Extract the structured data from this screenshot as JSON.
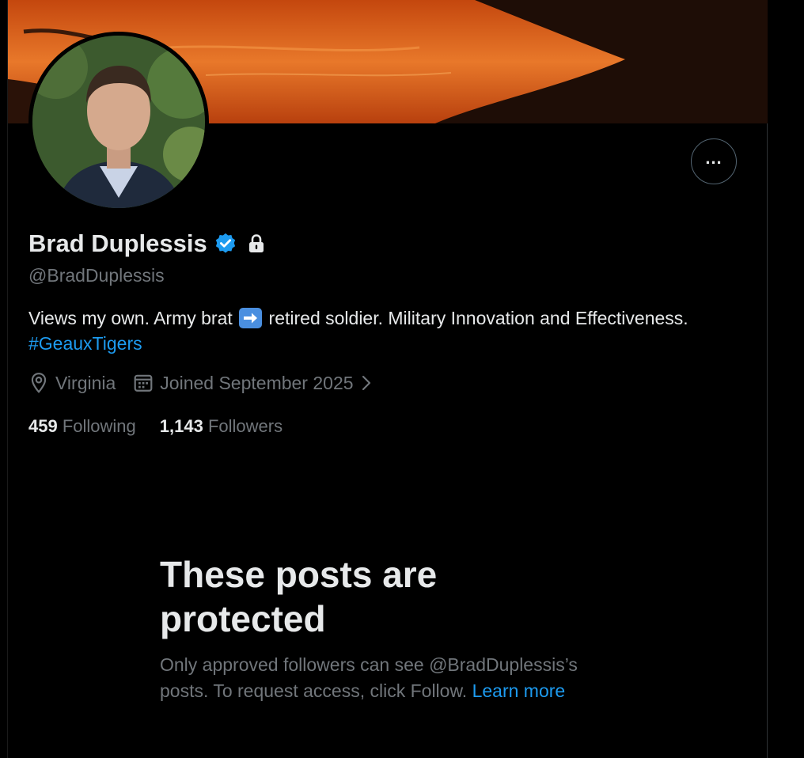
{
  "profile": {
    "display_name": "Brad Duplessis",
    "handle": "@BradDuplessis",
    "verified": true,
    "protected": true
  },
  "bio": {
    "text_before": "Views my own. Army brat",
    "emoji": "right-arrow-emoji",
    "text_after": "retired soldier. Military Innovation and Effectiveness.",
    "hashtag": "#GeauxTigers"
  },
  "meta": {
    "location": "Virginia",
    "joined": "Joined September 2025"
  },
  "stats": {
    "following_count": "459",
    "following_label": "Following",
    "followers_count": "1,143",
    "followers_label": "Followers"
  },
  "protected_notice": {
    "title_line1": "These posts are",
    "title_line2": "protected",
    "description": "Only approved followers can see @BradDuplessis’s posts. To request access, click Follow.",
    "learn_more": "Learn more"
  },
  "colors": {
    "background": "#000000",
    "accent": "#1d9bf0",
    "secondary_text": "#71767b",
    "primary_text": "#e7e9ea"
  },
  "icons": {
    "more": "more-horizontal-icon",
    "verified": "verified-badge-icon",
    "lock": "lock-icon",
    "location": "location-pin-icon",
    "calendar": "calendar-icon",
    "chevron": "chevron-right-icon"
  }
}
